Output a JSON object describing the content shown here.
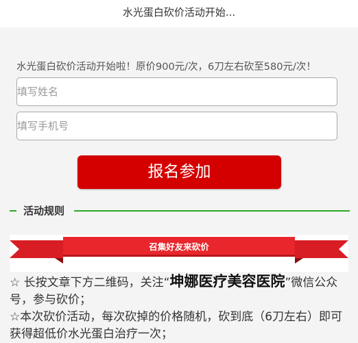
{
  "header": {
    "title": "水光蛋白砍价活动开始..."
  },
  "form": {
    "intro": "水光蛋白砍价活动开始啦！原价900元/次，6刀左右砍至580元/次！",
    "name_placeholder": "填写姓名",
    "phone_placeholder": "填写手机号",
    "submit_label": "报名参加"
  },
  "rules": {
    "title": "活动规则",
    "banner_text": "召集好友来砍价",
    "rule1_prefix": "☆ 长按文章下方二维码，关注“",
    "rule1_brand": "坤娜医疗美容医院",
    "rule1_suffix": "”微信公众号，参与砍价；",
    "rule2": "☆本次砍价活动，每次砍掉的价格随机，砍到底（6刀左右）即可获得超低价水光蛋白治疗一次；"
  },
  "colors": {
    "accent_red": "#d40000",
    "rule_green": "#26a926",
    "banner_red": "#e8262c"
  }
}
